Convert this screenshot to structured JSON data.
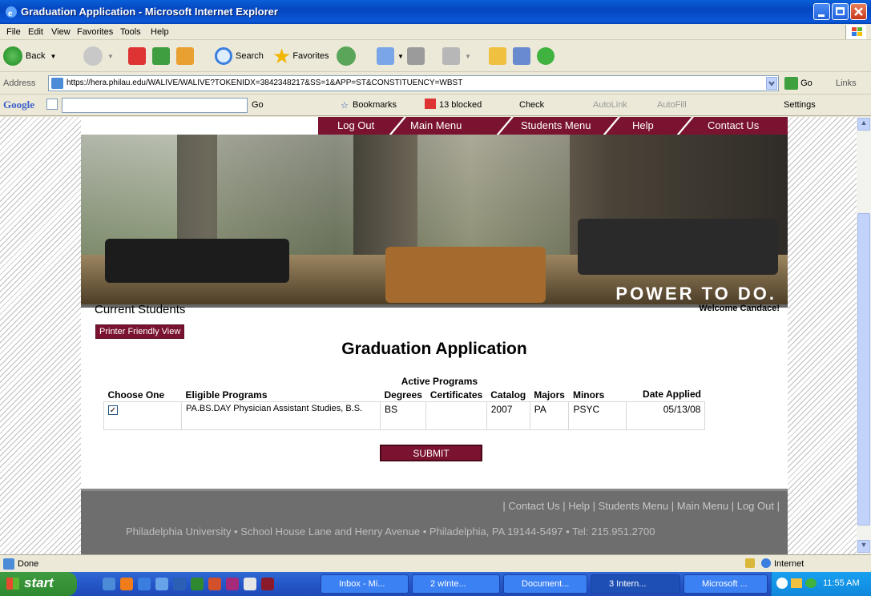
{
  "window": {
    "title": "Graduation Application - Microsoft Internet Explorer"
  },
  "menu": [
    "File",
    "Edit",
    "View",
    "Favorites",
    "Tools",
    "Help"
  ],
  "toolbar": {
    "back": "Back",
    "search": "Search",
    "favorites": "Favorites"
  },
  "address": {
    "label": "Address",
    "url": "https://hera.philau.edu/WALIVE/WALIVE?TOKENIDX=3842348217&SS=1&APP=ST&CONSTITUENCY=WBST",
    "go": "Go",
    "links": "Links"
  },
  "googlebar": {
    "brand": "Google",
    "go": "Go",
    "bookmarks": "Bookmarks",
    "blocked": "13 blocked",
    "check": "Check",
    "autolink": "AutoLink",
    "autofill": "AutoFill",
    "settings": "Settings"
  },
  "nav": [
    "Log Out",
    "Main Menu",
    "Students Menu",
    "Help",
    "Contact Us"
  ],
  "banner": {
    "slogan": "POWER TO DO."
  },
  "page": {
    "section": "Current Students",
    "welcome": "Welcome Candace!",
    "printer": "Printer Friendly View",
    "title": "Graduation Application",
    "submit": "SUBMIT"
  },
  "table": {
    "group_header": "Active Programs",
    "headers": {
      "choose": "Choose One",
      "eligible": "Eligible Programs",
      "degrees": "Degrees",
      "certificates": "Certificates",
      "catalog": "Catalog",
      "majors": "Majors",
      "minors": "Minors",
      "date": "Date Applied"
    },
    "rows": [
      {
        "checked": true,
        "program": "PA.BS.DAY Physician Assistant Studies, B.S.",
        "degrees": "BS",
        "certificates": "",
        "catalog": "2007",
        "majors": "PA",
        "minors": "PSYC",
        "date": "05/13/08"
      }
    ]
  },
  "footer": {
    "links": [
      "Contact Us",
      "Help",
      "Students Menu",
      "Main Menu",
      "Log Out"
    ],
    "address": "Philadelphia University • School House Lane and Henry Avenue • Philadelphia, PA 19144-5497 • Tel: 215.951.2700"
  },
  "status": {
    "text": "Done",
    "zone": "Internet"
  },
  "taskbar": {
    "start": "start",
    "tasks": [
      "Inbox - Mi...",
      "2 wInte...",
      "Document...",
      "3 Intern...",
      "Microsoft ..."
    ],
    "clock": "11:55 AM"
  }
}
